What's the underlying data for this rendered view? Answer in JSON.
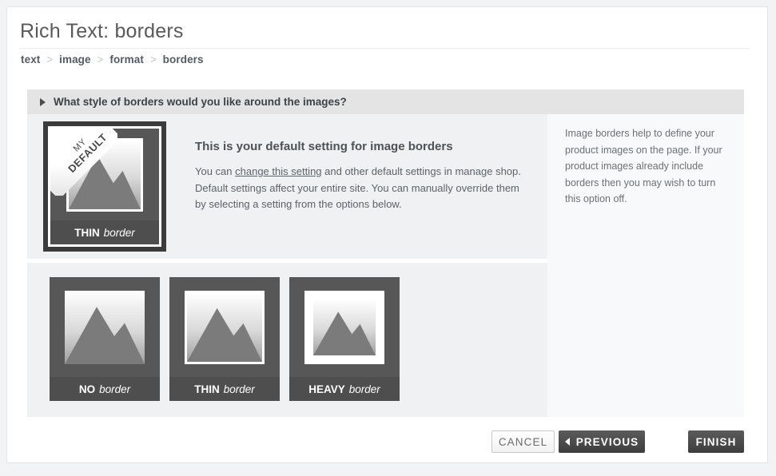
{
  "page": {
    "title": "Rich Text: borders"
  },
  "breadcrumb": {
    "separator": ">",
    "items": [
      {
        "label": "text"
      },
      {
        "label": "image"
      },
      {
        "label": "format"
      },
      {
        "label": "borders"
      }
    ]
  },
  "question": {
    "text": "What style of borders would you like around the images?",
    "toggle_icon": "triangle-right-icon"
  },
  "default_section": {
    "heading": "This is your default setting for image borders",
    "body_before": "You can ",
    "link_text": "change this setting",
    "body_after": " and other default settings in manage shop. Default settings affect your entire site. You can manually override them by selecting a setting from the options below.",
    "thumbnail": {
      "ribbon_line1": "MY",
      "ribbon_line2": "DEFAULT",
      "caption_strong": "THIN",
      "caption_em": "border",
      "border_style": "thin",
      "selected": true
    }
  },
  "options": [
    {
      "caption_strong": "NO",
      "caption_em": "border",
      "border_style": "none",
      "selected": false
    },
    {
      "caption_strong": "THIN",
      "caption_em": "border",
      "border_style": "thin",
      "selected": false
    },
    {
      "caption_strong": "HEAVY",
      "caption_em": "border",
      "border_style": "heavy",
      "selected": false
    }
  ],
  "help": {
    "text": "Image borders help to define your product images on the page. If your product images already include borders then you may wish to turn this option off."
  },
  "footer": {
    "cancel_label": "CANCEL",
    "previous_label": "PREVIOUS",
    "previous_icon": "triangle-left-icon",
    "finish_label": "FINISH"
  },
  "colors": {
    "page_background": "#f2f3f5",
    "card_background": "#ffffff",
    "panel_background": "#f0f1f3",
    "help_panel_background": "#f8f9fa",
    "question_bar": "#e4e4e4",
    "thumb_body": "#575757",
    "thumb_caption": "#4e4e4e",
    "button_dark": "#4a4a4a",
    "text_primary": "#4c5256",
    "text_secondary": "#6b7176"
  }
}
